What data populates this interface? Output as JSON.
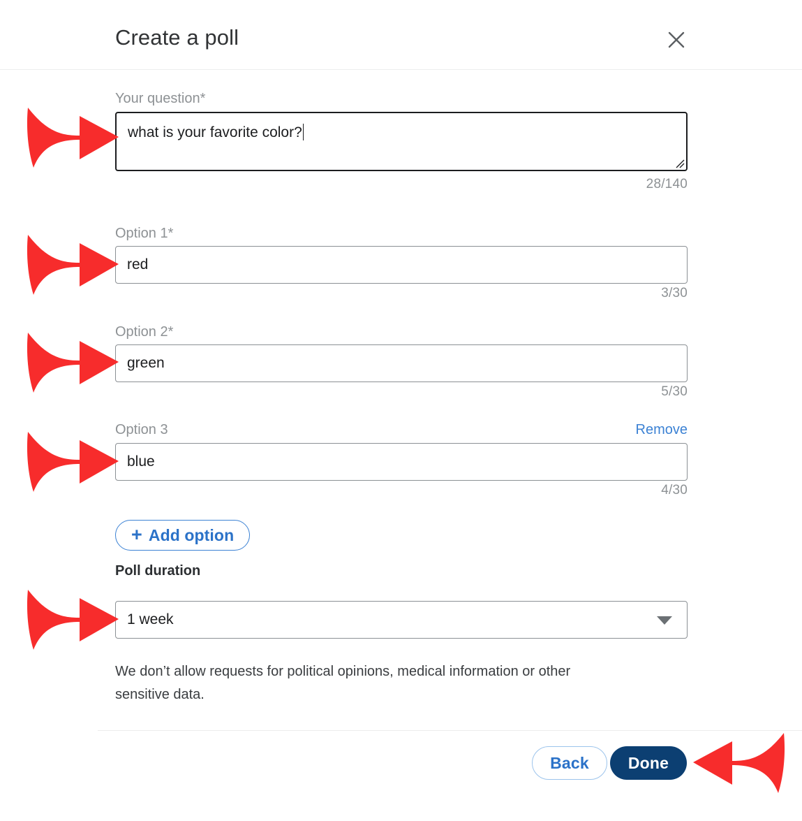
{
  "dialog": {
    "title": "Create a poll",
    "close_icon": "close-icon"
  },
  "question": {
    "label": "Your question*",
    "value": "what is your favorite color?",
    "counter": "28/140"
  },
  "options": [
    {
      "label": "Option 1*",
      "value": "red",
      "counter": "3/30",
      "remove_label": ""
    },
    {
      "label": "Option 2*",
      "value": "green",
      "counter": "5/30",
      "remove_label": ""
    },
    {
      "label": "Option 3",
      "value": "blue",
      "counter": "4/30",
      "remove_label": "Remove"
    }
  ],
  "add_option": {
    "plus": "+",
    "label": "Add option"
  },
  "duration": {
    "label": "Poll duration",
    "selected": "1 week",
    "dropdown_icon": "chevron-down-icon"
  },
  "disclaimer": "We don’t allow requests for political opinions, medical information or other sensitive data.",
  "footer": {
    "back_label": "Back",
    "done_label": "Done"
  },
  "colors": {
    "accent_blue": "#2b72c8",
    "link_blue": "#3c82d4",
    "done_navy": "#0c3f72",
    "annotation_red": "#f72c2c",
    "label_gray": "#8d9194"
  },
  "annotations": [
    {
      "name": "arrow-to-question-field",
      "direction": "right"
    },
    {
      "name": "arrow-to-option-1-field",
      "direction": "right"
    },
    {
      "name": "arrow-to-option-2-field",
      "direction": "right"
    },
    {
      "name": "arrow-to-option-3-field",
      "direction": "right"
    },
    {
      "name": "arrow-to-poll-duration-select",
      "direction": "right"
    },
    {
      "name": "arrow-to-done-button",
      "direction": "left"
    }
  ]
}
